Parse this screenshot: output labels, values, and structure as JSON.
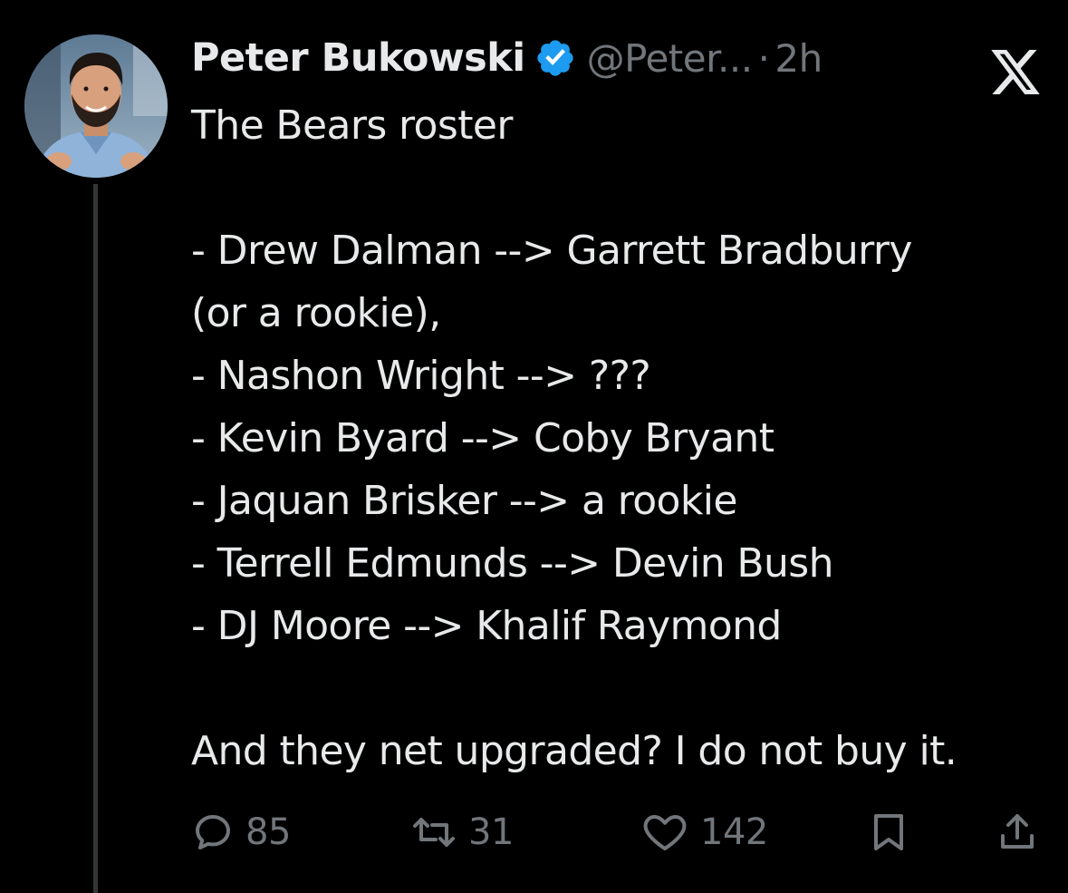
{
  "tweet": {
    "author": {
      "display_name": "Peter Bukowski",
      "handle": "@Peter...",
      "avatar_icon": "user-avatar-photo",
      "verified_icon": "verified-badge-icon"
    },
    "separator": "·",
    "time": "2h",
    "brand_icon": "x-logo-icon",
    "lines": [
      "The Bears roster",
      "",
      "- Drew Dalman --> Garrett Bradburry",
      "(or a rookie),",
      "- Nashon Wright --> ???",
      "- Kevin Byard --> Coby Bryant",
      "- Jaquan Brisker --> a rookie",
      "- Terrell Edmunds --> Devin Bush",
      "- DJ Moore --> Khalif Raymond",
      "",
      "And they net upgraded? I do not buy it."
    ],
    "actions": {
      "replies": "85",
      "reposts": "31",
      "likes": "142"
    }
  },
  "colors": {
    "background": "#000000",
    "text": "#e7e9ea",
    "muted": "#71767b",
    "verified_blue": "#1d9bf0",
    "thread_line": "#333639"
  }
}
